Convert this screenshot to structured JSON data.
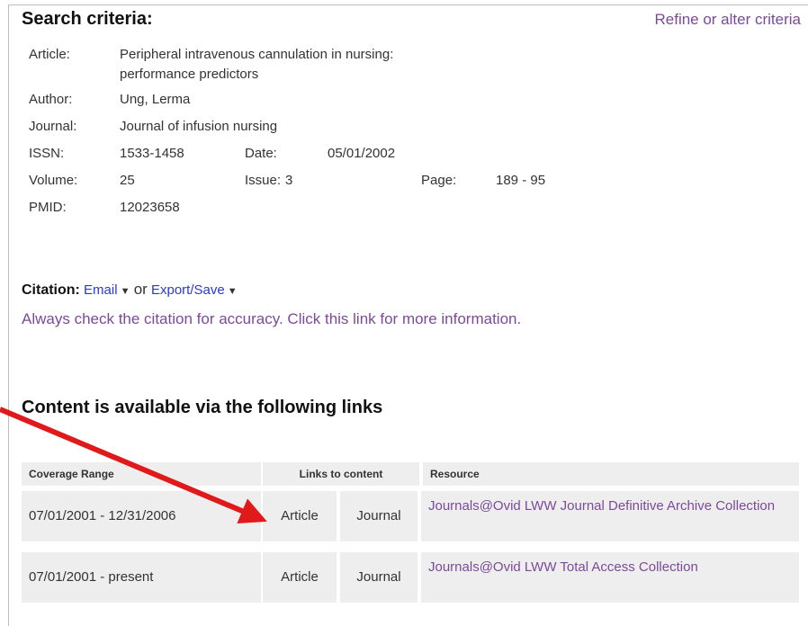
{
  "header": {
    "title": "Search criteria:",
    "refine_link": "Refine or alter criteria"
  },
  "criteria": {
    "article_label": "Article:",
    "article_line1": "Peripheral intravenous cannulation in nursing:",
    "article_line2": "performance predictors",
    "author_label": "Author:",
    "author": "Ung, Lerma",
    "journal_label": "Journal:",
    "journal": "Journal of infusion nursing",
    "issn_label": "ISSN:",
    "issn": "1533-1458",
    "date_label": "Date:",
    "date": "05/01/2002",
    "volume_label": "Volume:",
    "volume": "25",
    "issue_label": "Issue:",
    "issue": "3",
    "page_label": "Page:",
    "page": "189 - 95",
    "pmid_label": "PMID:",
    "pmid": "12023658"
  },
  "citation": {
    "label": "Citation:",
    "email": "Email",
    "or": "or",
    "export": "Export/Save",
    "note": "Always check the citation for accuracy. Click this link for more information."
  },
  "content": {
    "title": "Content is available via the following links",
    "headers": {
      "coverage": "Coverage Range",
      "links": "Links to content",
      "resource": "Resource"
    },
    "rows": [
      {
        "coverage": "07/01/2001 - 12/31/2006",
        "article": "Article",
        "journal": "Journal",
        "resource": "Journals@Ovid LWW Journal Definitive Archive Collection"
      },
      {
        "coverage": "07/01/2001 - present",
        "article": "Article",
        "journal": "Journal",
        "resource": "Journals@Ovid LWW Total Access Collection"
      }
    ]
  },
  "colors": {
    "link_purple": "#7b4a9a",
    "link_blue": "#2a38d8",
    "arrow_red": "#e0191b",
    "cell_bg": "#eeeeee"
  }
}
